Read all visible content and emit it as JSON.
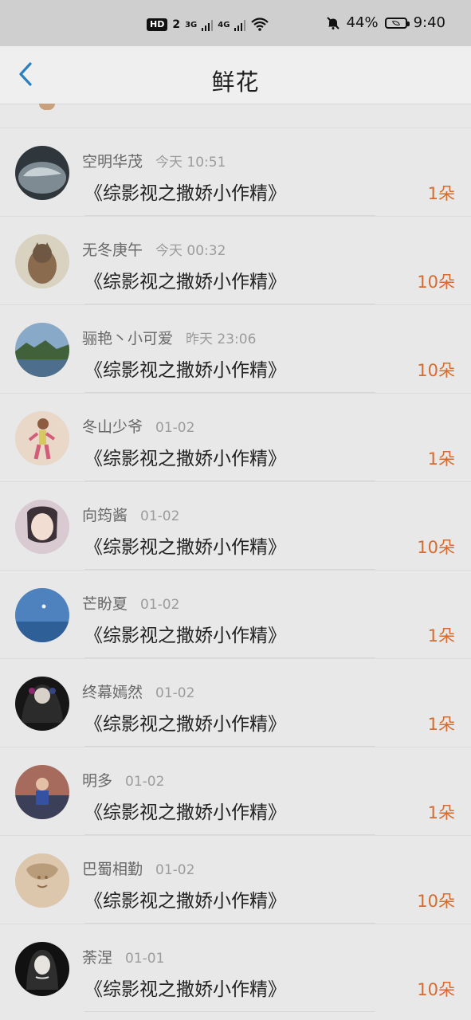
{
  "status_bar": {
    "hd_label": "HD",
    "hd_num": "2",
    "net1": "3G",
    "net2": "4G",
    "battery": "44%",
    "time": "9:40"
  },
  "navbar": {
    "title": "鲜花"
  },
  "rows": [
    {
      "username": "空明华茂",
      "time": "今天 10:51",
      "book": "《综影视之撒娇小作精》",
      "count": "1朵"
    },
    {
      "username": "无冬庚午",
      "time": "今天 00:32",
      "book": "《综影视之撒娇小作精》",
      "count": "10朵"
    },
    {
      "username": "骊艳丶小可爱",
      "time": "昨天 23:06",
      "book": "《综影视之撒娇小作精》",
      "count": "10朵"
    },
    {
      "username": "冬山少爷",
      "time": "01-02",
      "book": "《综影视之撒娇小作精》",
      "count": "1朵"
    },
    {
      "username": "向筠酱",
      "time": "01-02",
      "book": "《综影视之撒娇小作精》",
      "count": "10朵"
    },
    {
      "username": "芒盼夏",
      "time": "01-02",
      "book": "《综影视之撒娇小作精》",
      "count": "1朵"
    },
    {
      "username": "终幕嫣然",
      "time": "01-02",
      "book": "《综影视之撒娇小作精》",
      "count": "1朵"
    },
    {
      "username": "明多",
      "time": "01-02",
      "book": "《综影视之撒娇小作精》",
      "count": "1朵"
    },
    {
      "username": "巴蜀相勤",
      "time": "01-02",
      "book": "《综影视之撒娇小作精》",
      "count": "10朵"
    },
    {
      "username": "荼涅",
      "time": "01-01",
      "book": "《综影视之撒娇小作精》",
      "count": "10朵"
    }
  ]
}
